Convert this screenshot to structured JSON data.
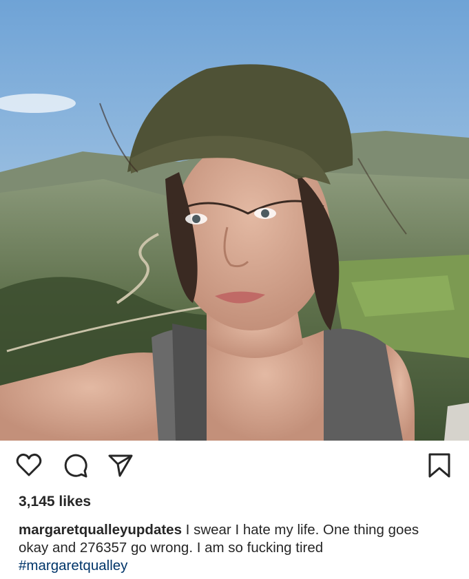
{
  "post": {
    "photo_description_icon": "photo",
    "likes_text": "3,145 likes",
    "username": "margaretqualleyupdates",
    "caption_text": " I swear I hate my life. One thing goes okay and 276357 go wrong. I am so fucking tired",
    "hashtag": "#margaretqualley"
  },
  "icons": {
    "like": "heart-icon",
    "comment": "comment-icon",
    "share": "send-icon",
    "save": "bookmark-icon"
  },
  "colors": {
    "text": "#262626",
    "hashtag": "#003569",
    "icon": "#262626"
  }
}
